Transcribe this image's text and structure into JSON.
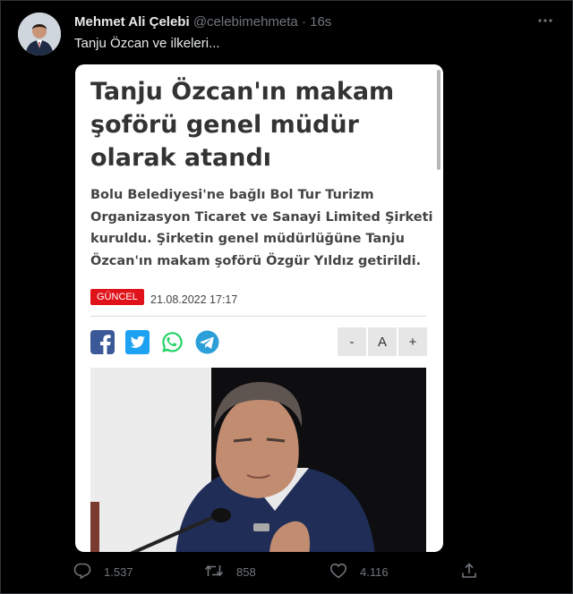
{
  "tweet": {
    "author": "Mehmet Ali Çelebi",
    "handle": "@celebimehmeta",
    "separator": "·",
    "time": "16s",
    "text": "Tanju Özcan ve ilkeleri...",
    "more_icon": "more-horizontal-icon"
  },
  "article": {
    "headline": "Tanju Özcan'ın makam şoförü genel müdür olarak atandı",
    "summary": "Bolu Belediyesi'ne bağlı Bol Tur Turizm Organizasyon Ticaret ve Sanayi Limited Şirketi kuruldu. Şirketin genel müdürlüğüne Tanju Özcan'ın makam şoförü Özgür Yıldız getirildi.",
    "badge": "GÜNCEL",
    "badge_color": "#e0121a",
    "date": "21.08.2022 17:17",
    "share_icons": [
      "facebook-icon",
      "twitter-icon",
      "whatsapp-icon",
      "telegram-icon"
    ],
    "font_controls": [
      "-",
      "A",
      "+"
    ]
  },
  "actions": {
    "replies": "1.537",
    "retweets": "858",
    "likes": "4.116",
    "icons": [
      "reply-icon",
      "retweet-icon",
      "like-icon",
      "share-icon"
    ]
  },
  "colors": {
    "background": "#000000",
    "muted": "#71767b",
    "facebook": "#3b5998",
    "twitter": "#1da1f2",
    "whatsapp": "#25d366",
    "telegram": "#2d9fd8"
  }
}
